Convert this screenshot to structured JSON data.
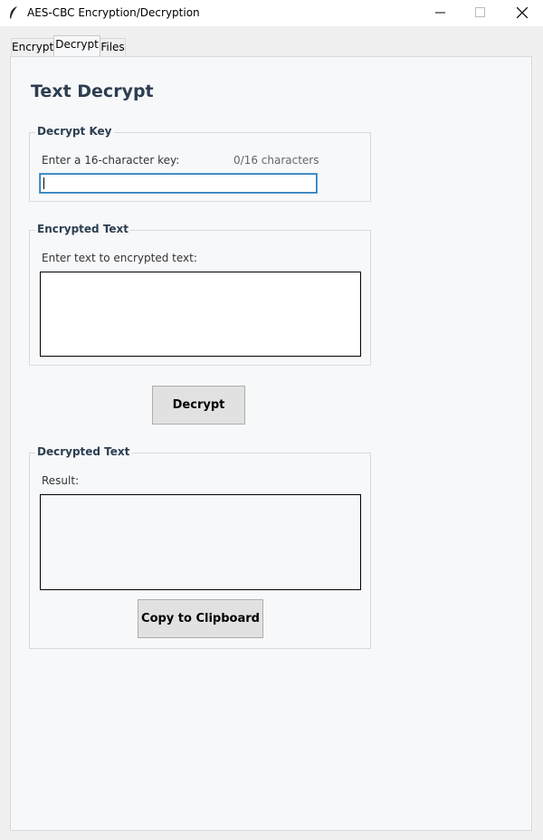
{
  "window": {
    "title": "AES-CBC Encryption/Decryption",
    "controls": [
      "minimize-icon",
      "maximize-icon",
      "close-icon"
    ]
  },
  "tabs": [
    {
      "label": "Encrypt",
      "selected": false
    },
    {
      "label": "Decrypt",
      "selected": true
    },
    {
      "label": "Files",
      "selected": false
    }
  ],
  "page": {
    "title": "Text Decrypt"
  },
  "key_group": {
    "title": "Decrypt Key",
    "prompt": "Enter a 16-character key:",
    "counter": "0/16 characters",
    "value": ""
  },
  "encrypted_group": {
    "title": "Encrypted Text",
    "prompt": "Enter text to encrypted text:",
    "value": ""
  },
  "decrypt_button": {
    "label": "Decrypt"
  },
  "result_group": {
    "title": "Decrypted Text",
    "prompt": "Result:",
    "value": "",
    "copy_label": "Copy to Clipboard"
  },
  "colors": {
    "heading": "#2c3e50",
    "panel_bg": "#f7f8fa",
    "button_bg": "#e1e1e1",
    "focus_border": "#2a7ab8"
  }
}
